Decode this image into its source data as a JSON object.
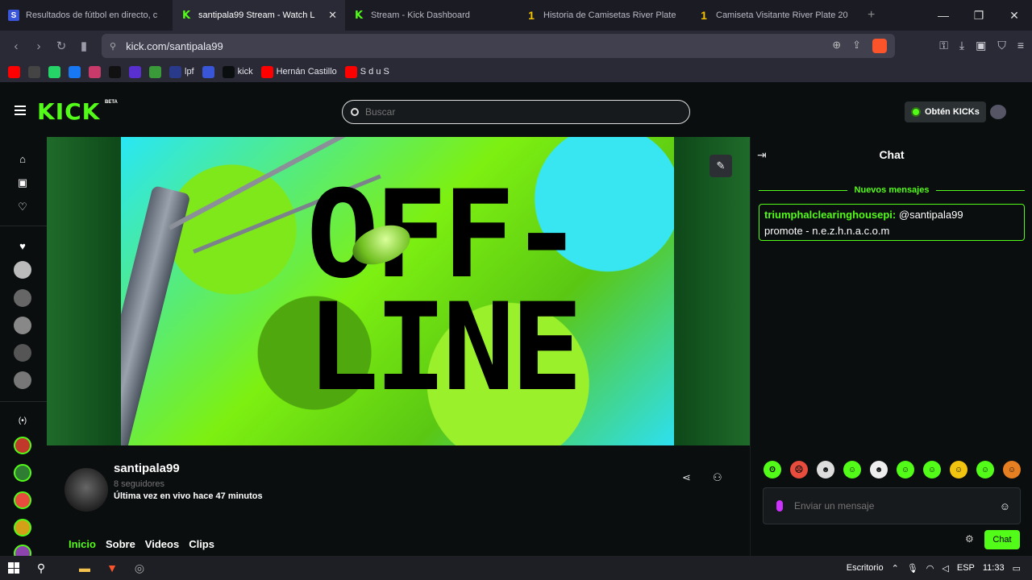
{
  "browser": {
    "tabs": [
      {
        "title": "Resultados de fútbol en directo, c",
        "icon": "sofascore-icon"
      },
      {
        "title": "santipala99 Stream - Watch L",
        "icon": "kick-icon",
        "active": true
      },
      {
        "title": "Stream - Kick Dashboard",
        "icon": "kick-icon"
      },
      {
        "title": "Historia de Camisetas River Plate",
        "icon": "one-icon"
      },
      {
        "title": "Camiseta Visitante River Plate 20",
        "icon": "one-icon"
      }
    ],
    "url": "kick.com/santipala99",
    "bookmarks": [
      {
        "label": "",
        "icon": "youtube-icon",
        "color": "#ff0000"
      },
      {
        "label": "",
        "icon": "settings-icon",
        "color": "#444444"
      },
      {
        "label": "",
        "icon": "whatsapp-icon",
        "color": "#25d366"
      },
      {
        "label": "",
        "icon": "facebook-icon",
        "color": "#1877f2"
      },
      {
        "label": "",
        "icon": "app-icon",
        "color": "#c83a6a"
      },
      {
        "label": "",
        "icon": "tiktok-icon",
        "color": "#111111"
      },
      {
        "label": "",
        "icon": "mx-icon",
        "color": "#5a2fd0"
      },
      {
        "label": "",
        "icon": "globe-icon",
        "color": "#3a9a3a"
      },
      {
        "label": "lpf",
        "icon": "lpf-icon",
        "color": "#2a3a8a"
      },
      {
        "label": "",
        "icon": "sofascore-icon",
        "color": "#3955d8"
      },
      {
        "label": "kick",
        "icon": "kick-icon",
        "color": "#0b0e0f"
      },
      {
        "label": "Hernán Castillo",
        "icon": "youtube-icon",
        "color": "#ff0000"
      },
      {
        "label": "S d u S",
        "icon": "youtube-icon",
        "color": "#ff0000"
      }
    ]
  },
  "kick": {
    "logo": "KICK",
    "beta": "BETA",
    "search_placeholder": "Buscar",
    "kicks_button": "Obtén KICKs"
  },
  "player": {
    "offline_line1": "OFF-",
    "offline_line2": "LINE"
  },
  "channel": {
    "name": "santipala99",
    "followers": "8 seguidores",
    "last_live": "Última vez en vivo hace 47 minutos",
    "tabs": [
      "Inicio",
      "Sobre",
      "Videos",
      "Clips"
    ]
  },
  "chat": {
    "title": "Chat",
    "new_messages": "Nuevos mensajes",
    "message_user": "triumphalclearinghousepi:",
    "message_text_1": "@santipala99",
    "message_text_2": "promote - n.e.z.h.n.a.c.o.m",
    "input_placeholder": "Enviar un mensaje",
    "send_label": "Chat"
  },
  "taskbar": {
    "desktop_label": "Escritorio",
    "language": "ESP",
    "time": "11:33"
  },
  "colors": {
    "accent": "#53fc18"
  }
}
